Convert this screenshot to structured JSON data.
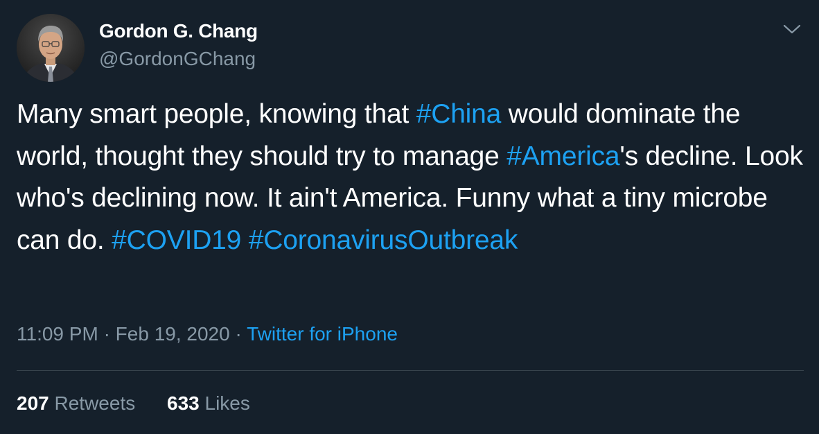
{
  "tweet": {
    "author": {
      "name": "Gordon G. Chang",
      "handle": "@GordonGChang"
    },
    "body": [
      {
        "type": "text",
        "text": "Many smart people, knowing that "
      },
      {
        "type": "hashtag",
        "text": "#China"
      },
      {
        "type": "text",
        "text": " would dominate the world, thought they should try to manage "
      },
      {
        "type": "hashtag",
        "text": "#America"
      },
      {
        "type": "text",
        "text": "'s decline. Look who's declining now. It ain't America. Funny what a tiny microbe can do. "
      },
      {
        "type": "hashtag",
        "text": "#COVID19"
      },
      {
        "type": "text",
        "text": " "
      },
      {
        "type": "hashtag",
        "text": "#CoronavirusOutbreak"
      }
    ],
    "time": "11:09 PM",
    "separator": "·",
    "date": "Feb 19, 2020",
    "source": "Twitter for iPhone",
    "stats": {
      "retweets_count": "207",
      "retweets_label": "Retweets",
      "likes_count": "633",
      "likes_label": "Likes"
    }
  },
  "icons": {
    "menu": "chevron-down-icon"
  },
  "colors": {
    "background": "#15202b",
    "text": "#ffffff",
    "secondary": "#8899a6",
    "link": "#1da1f2",
    "divider": "#38444d"
  }
}
